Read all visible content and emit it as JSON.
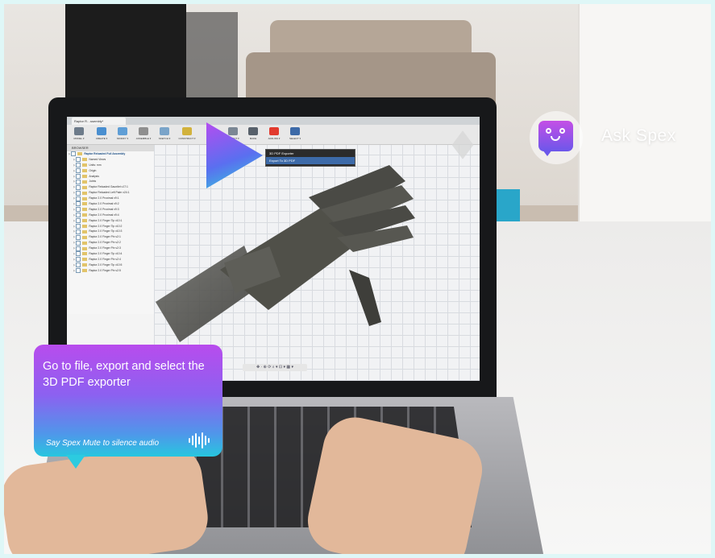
{
  "assistant": {
    "name": "Ask Spex",
    "icon": "robot-face-chat-icon",
    "accent_top": "#c44fe6",
    "accent_bottom": "#6c57ea"
  },
  "instruction_card": {
    "message": "Go to file, export and select the 3D PDF exporter",
    "hint": "Say Spex Mute to silence audio",
    "icon": "audio-wave-icon"
  },
  "cad_app": {
    "tab_title": "Raptor R…ssembly*",
    "toolbar": [
      {
        "label": "MODEL ▾"
      },
      {
        "label": "CREATE ▾"
      },
      {
        "label": "MODIFY ▾"
      },
      {
        "label": "ASSEMBLE ▾"
      },
      {
        "label": "SKETCH ▾"
      },
      {
        "label": "CONSTRUCT ▾"
      },
      {
        "label": "INSPECT ▾"
      },
      {
        "label": "MAKE"
      },
      {
        "label": "ADD-INS ▾"
      },
      {
        "label": "SELECT ▾"
      }
    ],
    "browser_header": "BROWSER",
    "tree": [
      "Raptor Reloaded Full Assembly",
      "Named Views",
      "Units: mm",
      "Origin",
      "Analysis",
      "Joints",
      "Raptor Reloaded Gauntlet v17:1",
      "Raptor Reloaded Left Palm v24:1",
      "Raptor 2.0 Proximal v9:1",
      "Raptor 2.0 Proximal v9:2",
      "Raptor 2.0 Proximal v9:3",
      "Raptor 2.0 Proximal v9:4",
      "Raptor 2.0 Finger Tip v10:1",
      "Raptor 2.0 Finger Tip v10:2",
      "Raptor 2.0 Finger Tip v10:3",
      "Raptor 2.0 Finger Pin v2:1",
      "Raptor 2.0 Finger Pin v2:2",
      "Raptor 2.0 Finger Pin v2:3",
      "Raptor 2.0 Finger Tip v10:4",
      "Raptor 2.0 Finger Pin v2:4",
      "Raptor 2.0 Finger Tip v10:5",
      "Raptor 2.0 Finger Pin v2:5"
    ],
    "export_menu": [
      {
        "label": "3D PDF Exporter",
        "selected": false
      },
      {
        "label": "Export To 3D PDF",
        "selected": true
      }
    ],
    "nav_bar": "✥ · ⊕ ⟳ ⌕ ▾ ⊡ ▾ ▦ ▾"
  }
}
